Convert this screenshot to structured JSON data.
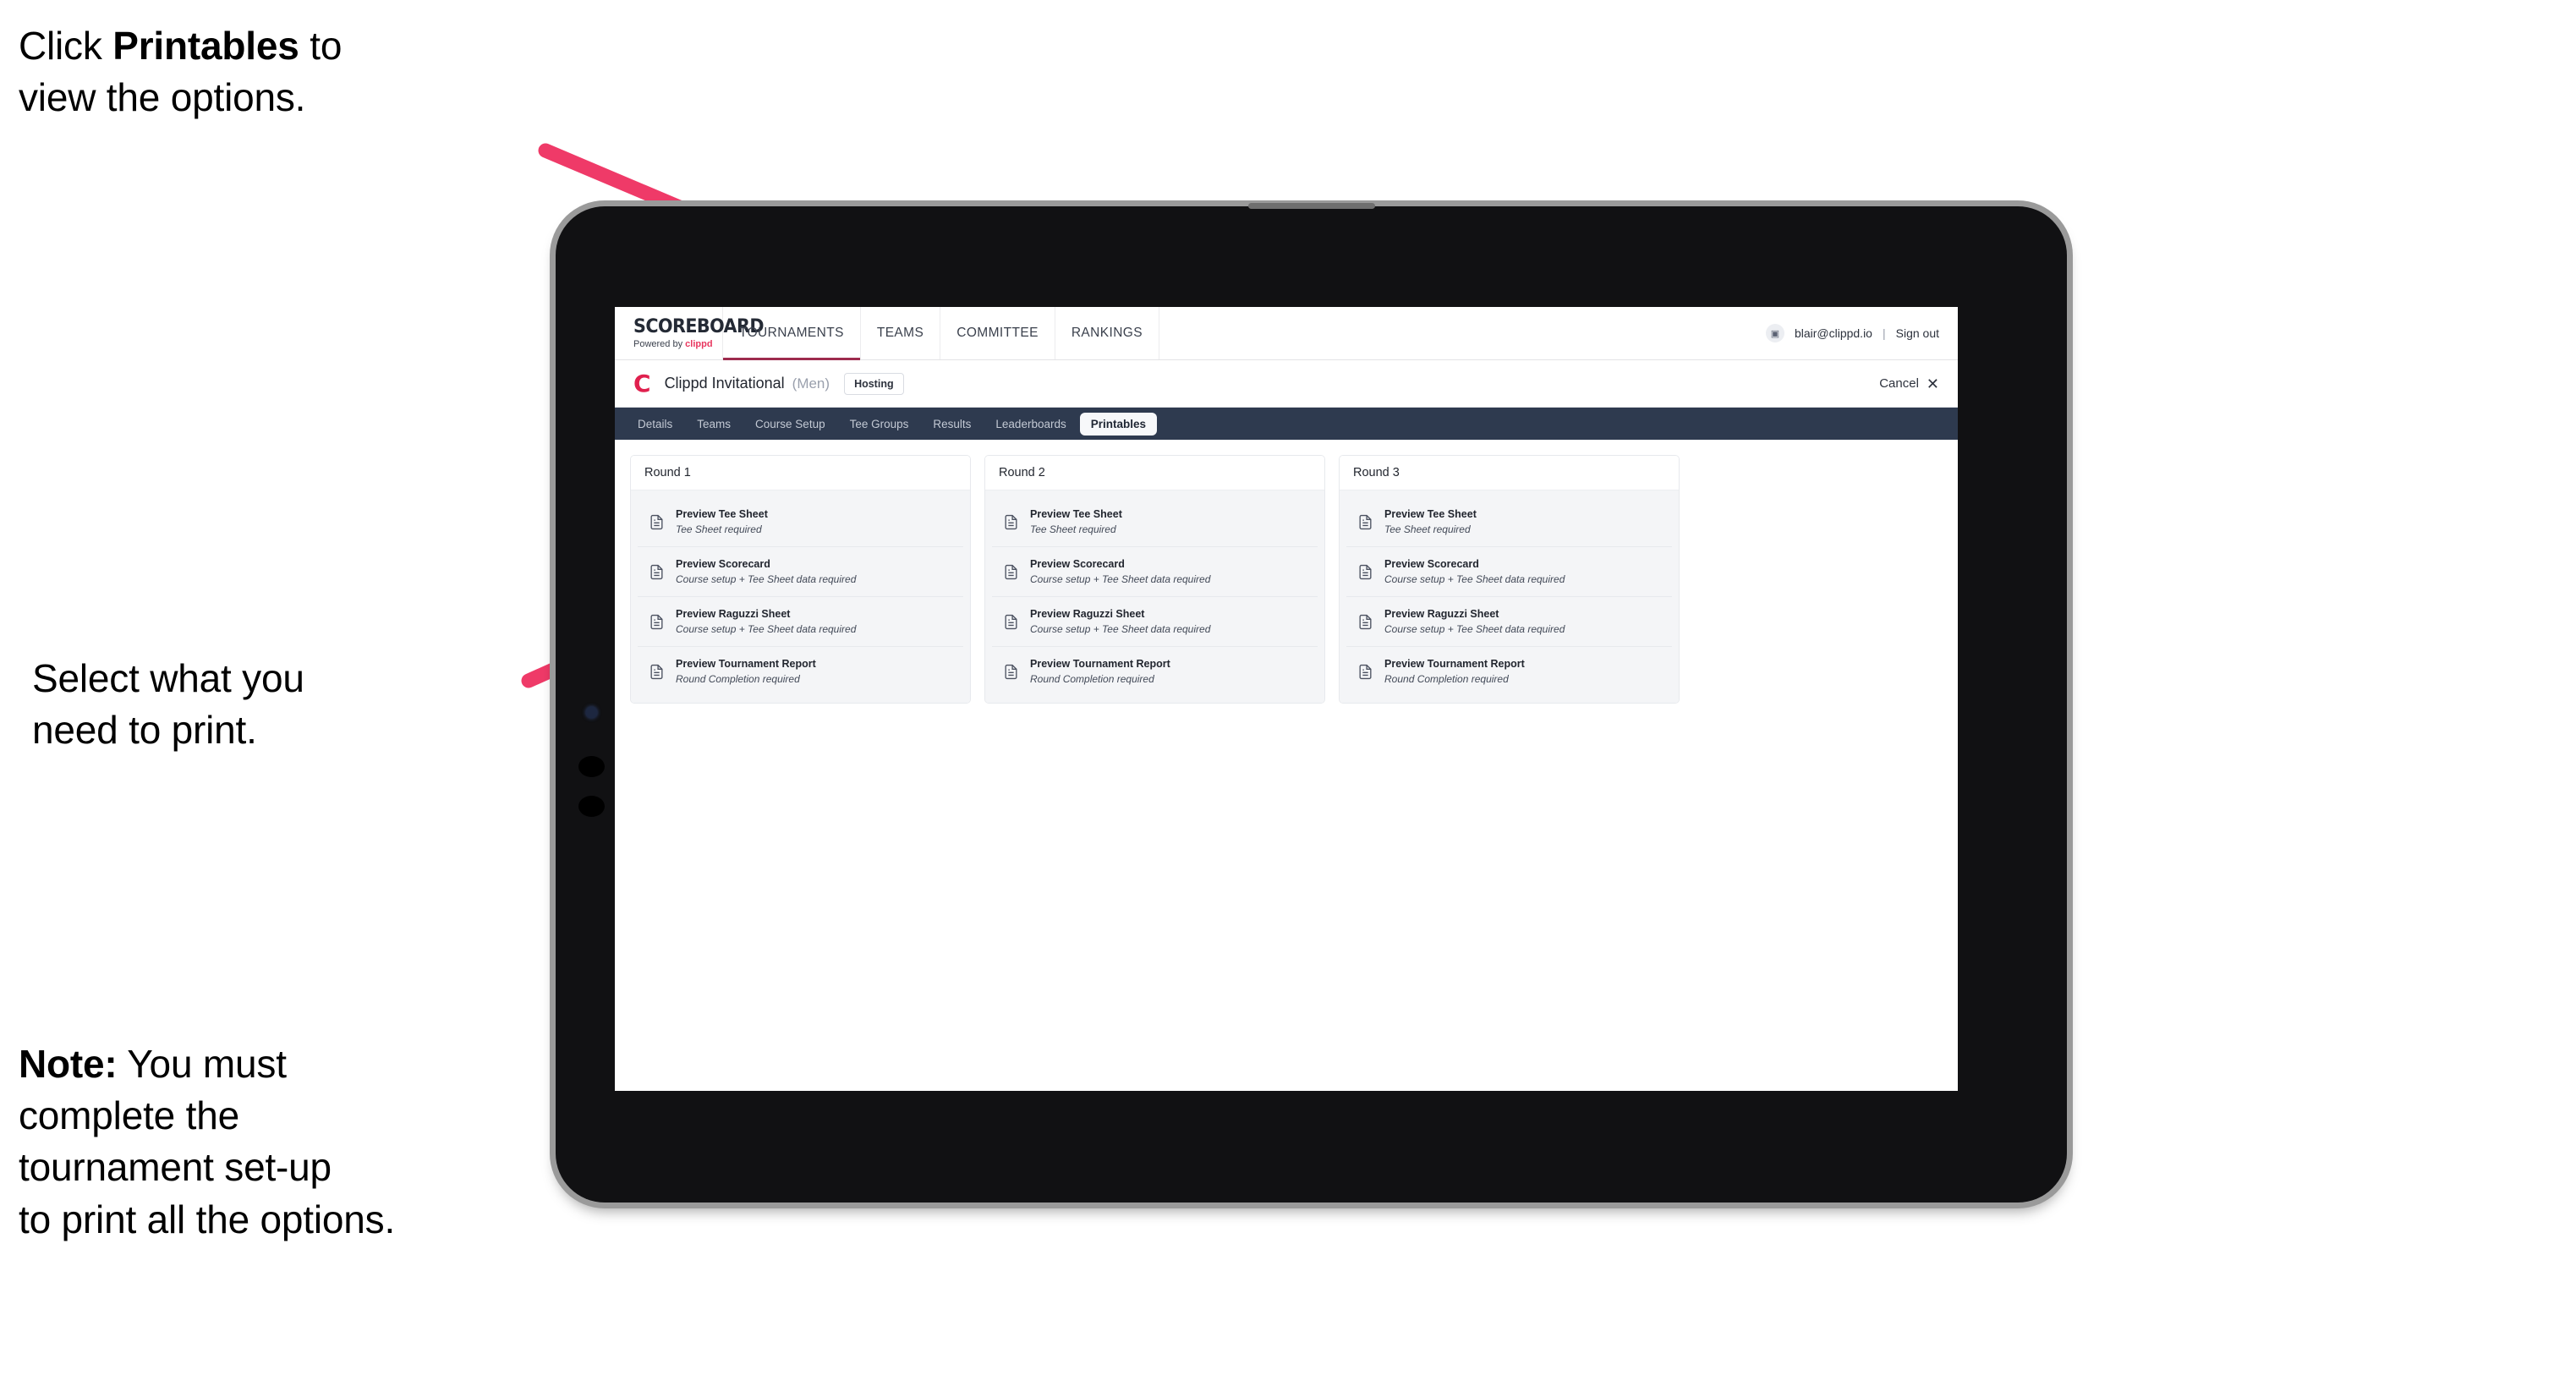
{
  "annotations": [
    {
      "id": "a1",
      "html_parts": [
        "Click ",
        "Printables",
        " to\nview the options."
      ]
    },
    {
      "id": "a2",
      "text": "Select what you\n need to print."
    },
    {
      "id": "a3",
      "html_parts": [
        "Note:",
        " You must\ncomplete the\ntournament set-up\nto print all the options."
      ]
    }
  ],
  "annotation_text": {
    "line1_pre": "Click ",
    "line1_bold": "Printables",
    "line1_post": " to\nview the options.",
    "line2": "Select what you\n need to print.",
    "line3_bold": "Note:",
    "line3_post": " You must\ncomplete the\ntournament set-up\nto print all the options."
  },
  "colors": {
    "arrow": "#ef3a68",
    "accent_pink": "#e0204e",
    "brand_red": "#e8375f",
    "nav_underline": "#9d2b4e",
    "subtab_bar": "#2e3a4f",
    "card_bg": "#f4f5f7",
    "tablet_body": "#111113",
    "tablet_bezel": "#9a9a9a"
  },
  "appbar": {
    "brand_title": "SCOREBOARD",
    "brand_sub_prefix": "Powered by ",
    "brand_sub_accent": "clippd",
    "nav_items": [
      {
        "label": "TOURNAMENTS",
        "active": true
      },
      {
        "label": "TEAMS",
        "active": false
      },
      {
        "label": "COMMITTEE",
        "active": false
      },
      {
        "label": "RANKINGS",
        "active": false
      }
    ],
    "avatar_glyph": "▣",
    "user_email": "blair@clippd.io",
    "separator": "|",
    "sign_out": "Sign out"
  },
  "tournament_bar": {
    "logo_letter": "C",
    "name": "Clippd Invitational",
    "gender": "(Men)",
    "badge": "Hosting",
    "cancel_label": "Cancel",
    "cancel_icon": "✕"
  },
  "subtabs": [
    {
      "label": "Details",
      "active": false
    },
    {
      "label": "Teams",
      "active": false
    },
    {
      "label": "Course Setup",
      "active": false
    },
    {
      "label": "Tee Groups",
      "active": false
    },
    {
      "label": "Results",
      "active": false
    },
    {
      "label": "Leaderboards",
      "active": false
    },
    {
      "label": "Printables",
      "active": true
    }
  ],
  "rounds": [
    {
      "title": "Round 1",
      "items": [
        {
          "icon": "document-icon",
          "title": "Preview Tee Sheet",
          "sub": "Tee Sheet required"
        },
        {
          "icon": "document-icon",
          "title": "Preview Scorecard",
          "sub": "Course setup + Tee Sheet data required"
        },
        {
          "icon": "document-icon",
          "title": "Preview Raguzzi Sheet",
          "sub": "Course setup + Tee Sheet data required"
        },
        {
          "icon": "document-icon",
          "title": "Preview Tournament Report",
          "sub": "Round Completion required"
        }
      ]
    },
    {
      "title": "Round 2",
      "items": [
        {
          "icon": "document-icon",
          "title": "Preview Tee Sheet",
          "sub": "Tee Sheet required"
        },
        {
          "icon": "document-icon",
          "title": "Preview Scorecard",
          "sub": "Course setup + Tee Sheet data required"
        },
        {
          "icon": "document-icon",
          "title": "Preview Raguzzi Sheet",
          "sub": "Course setup + Tee Sheet data required"
        },
        {
          "icon": "document-icon",
          "title": "Preview Tournament Report",
          "sub": "Round Completion required"
        }
      ]
    },
    {
      "title": "Round 3",
      "items": [
        {
          "icon": "document-icon",
          "title": "Preview Tee Sheet",
          "sub": "Tee Sheet required"
        },
        {
          "icon": "document-icon",
          "title": "Preview Scorecard",
          "sub": "Course setup + Tee Sheet data required"
        },
        {
          "icon": "document-icon",
          "title": "Preview Raguzzi Sheet",
          "sub": "Course setup + Tee Sheet data required"
        },
        {
          "icon": "document-icon",
          "title": "Preview Tournament Report",
          "sub": "Round Completion required"
        }
      ]
    }
  ]
}
